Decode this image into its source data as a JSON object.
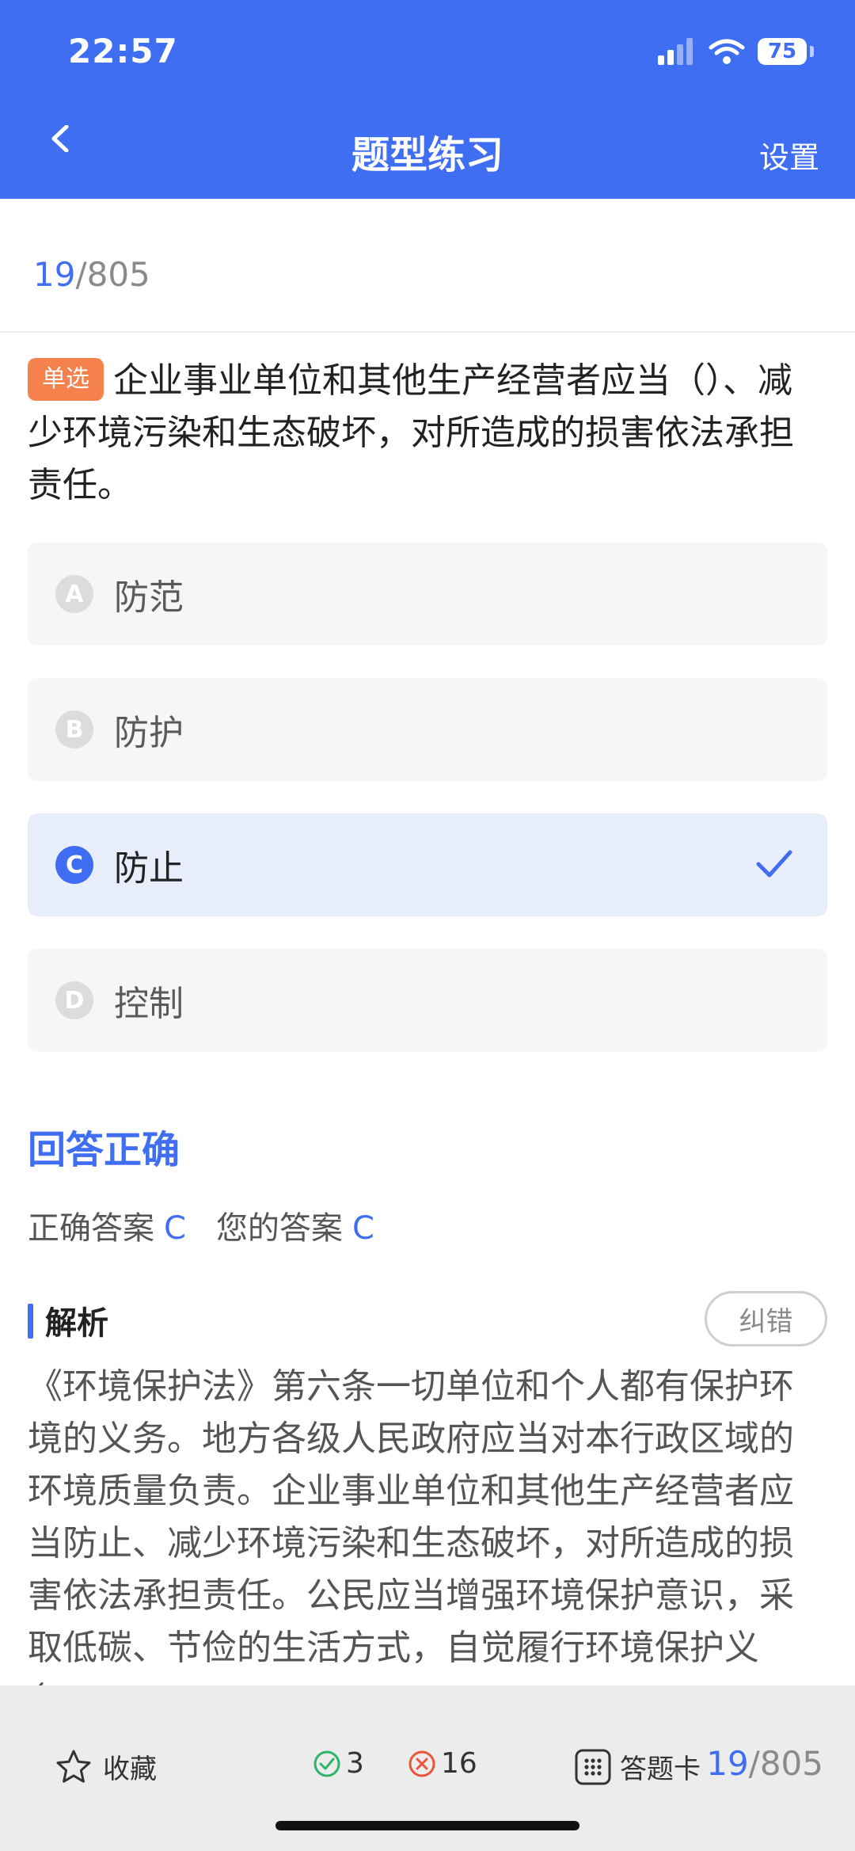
{
  "status_bar": {
    "time": "22:57",
    "battery": "75"
  },
  "header": {
    "title": "题型练习",
    "settings_label": "设置"
  },
  "progress": {
    "current": "19",
    "total": "/805"
  },
  "question": {
    "type_tag": "单选",
    "text": "企业事业单位和其他生产经营者应当（）、减少环境污染和生态破坏，对所造成的损害依法承担责任。"
  },
  "options": [
    {
      "letter": "A",
      "text": "防范",
      "selected": false
    },
    {
      "letter": "B",
      "text": "防护",
      "selected": false
    },
    {
      "letter": "C",
      "text": "防止",
      "selected": true
    },
    {
      "letter": "D",
      "text": "控制",
      "selected": false
    }
  ],
  "result": {
    "status": "回答正确",
    "correct_label": "正确答案",
    "correct_value": "C",
    "your_label": "您的答案",
    "your_value": "C"
  },
  "analysis": {
    "title": "解析",
    "report_label": "纠错",
    "text": "《环境保护法》第六条一切单位和个人都有保护环境的义务。地方各级人民政府应当对本行政区域的环境质量负责。企业事业单位和其他生产经营者应当防止、减少环境污染和生态破坏，对所造成的损害依法承担责任。公民应当增强环境保护意识，采取低碳、节俭的生活方式，自觉履行环境保护义务。"
  },
  "bottom_bar": {
    "favorite_label": "收藏",
    "correct_count": "3",
    "wrong_count": "16",
    "answer_card_label": "答题卡",
    "progress_current": "19",
    "progress_total": "/805"
  },
  "colors": {
    "accent": "#3f6ef3",
    "tag": "#f5814d",
    "correct": "#2fb36b",
    "wrong": "#e9543b"
  }
}
